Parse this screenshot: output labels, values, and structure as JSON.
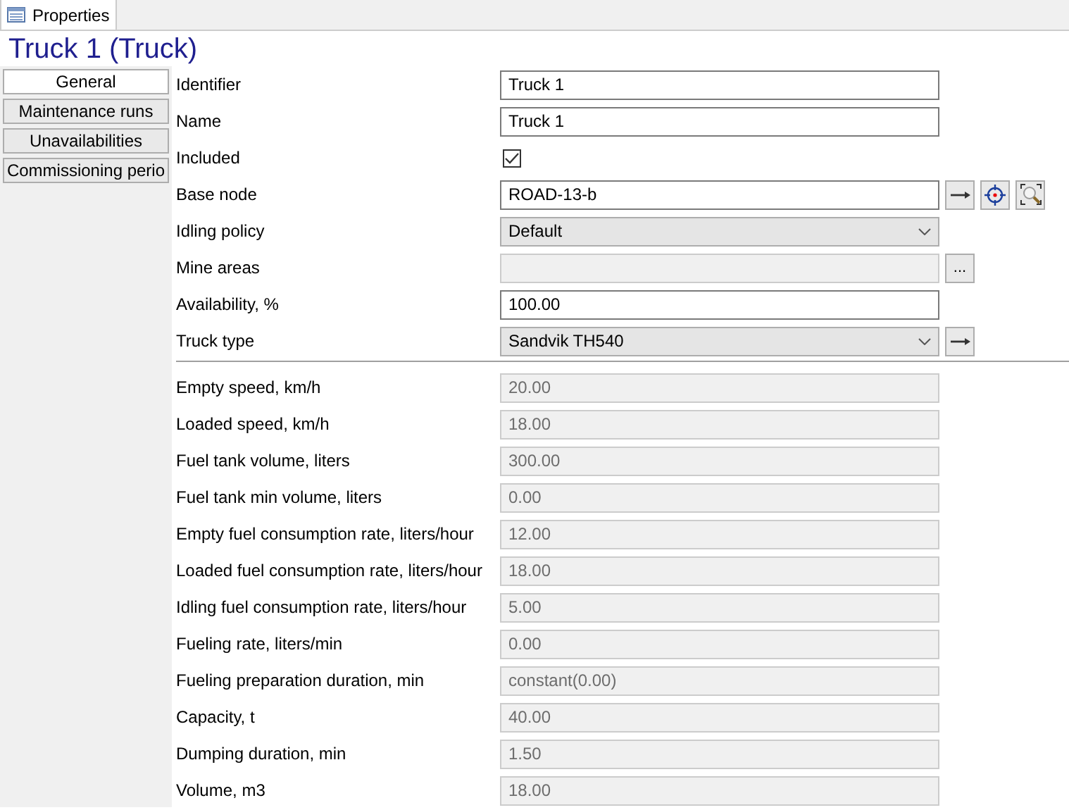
{
  "tab": {
    "label": "Properties",
    "selected": true
  },
  "title": "Truck 1 (Truck)",
  "sidebar": [
    {
      "label": "General",
      "selected": true
    },
    {
      "label": "Maintenance runs",
      "selected": false
    },
    {
      "label": "Unavailabilities",
      "selected": false
    },
    {
      "label": "Commissioning perio",
      "selected": false
    }
  ],
  "fields": [
    {
      "label": "Identifier",
      "kind": "text",
      "value": "Truck 1"
    },
    {
      "label": "Name",
      "kind": "text",
      "value": "Truck 1"
    },
    {
      "label": "Included",
      "kind": "check",
      "checked": true
    },
    {
      "label": "Base node",
      "kind": "text",
      "value": "ROAD-13-b",
      "buttons": [
        {
          "kind": "arrow"
        },
        {
          "kind": "target"
        },
        {
          "kind": "zoom"
        }
      ]
    },
    {
      "label": "Idling policy",
      "kind": "combo",
      "value": "Default"
    },
    {
      "label": "Mine areas",
      "kind": "disabled",
      "buttons": [
        {
          "kind": "ellipsis",
          "text": "..."
        }
      ]
    },
    {
      "label": "Availability, %",
      "kind": "text",
      "value": "100.00"
    },
    {
      "label": "Truck type",
      "kind": "combo",
      "value": "Sandvik TH540",
      "buttons": [
        {
          "kind": "arrow"
        }
      ]
    }
  ],
  "truck_type_fields": [
    {
      "label": "Empty speed, km/h",
      "value": "20.00"
    },
    {
      "label": "Loaded speed, km/h",
      "value": "18.00"
    },
    {
      "label": "Fuel tank volume, liters",
      "value": "300.00"
    },
    {
      "label": "Fuel tank min volume, liters",
      "value": "0.00"
    },
    {
      "label": "Empty fuel consumption rate, liters/hour",
      "value": "12.00"
    },
    {
      "label": "Loaded fuel consumption rate, liters/hour",
      "value": "18.00"
    },
    {
      "label": "Idling fuel consumption rate, liters/hour",
      "value": "5.00"
    },
    {
      "label": "Fueling rate, liters/min",
      "value": "0.00"
    },
    {
      "label": "Fueling preparation duration, min",
      "value": "constant(0.00)"
    },
    {
      "label": "Capacity, t",
      "value": "40.00"
    },
    {
      "label": "Dumping duration, min",
      "value": "1.50"
    },
    {
      "label": "Volume, m3",
      "value": "18.00"
    }
  ]
}
